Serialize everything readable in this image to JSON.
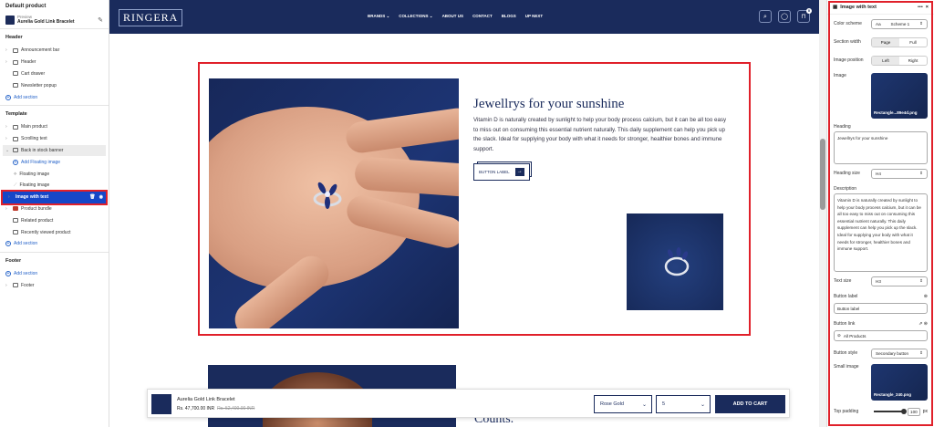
{
  "left_panel": {
    "title": "Default product",
    "preview_label": "Preview",
    "preview_product": "Aurelia Gold Link Bracelet",
    "header_group": {
      "title": "Header",
      "items": [
        "Announcement bar",
        "Header",
        "Cart drawer",
        "Newsletter popup"
      ],
      "add": "Add section"
    },
    "template_group": {
      "title": "Template",
      "items": [
        "Main product",
        "Scrolling text",
        "Back in stock banner"
      ],
      "add_floating": "Add Floating image",
      "floating_items": [
        "Floating image",
        "Floating image"
      ],
      "selected": "Image with text",
      "items_after": [
        "Product bundle",
        "Related product",
        "Recently viewed product"
      ],
      "add": "Add section"
    },
    "footer_group": {
      "title": "Footer",
      "add": "Add section",
      "items": [
        "Footer"
      ]
    }
  },
  "site": {
    "logo": "RINGERA",
    "menu": [
      "BRANDS ⌄",
      "COLLECTIONS ⌄",
      "ABOUT US",
      "CONTACT",
      "BLOGS",
      "UP NEXT"
    ],
    "heading": "Jewellrys for your sunshine",
    "description": "Vitamin D is naturally created by sunlight to help your body process calcium, but it can be all too easy to miss out on consuming this essential nutrient naturally. This daily supplement can help you pick up the slack. Ideal for supplying your body with what it needs for stronger, healthier bones and immune support.",
    "button_label": "BUTTON LABEL",
    "lower_text": "Counts.",
    "cart_badge": "0"
  },
  "sticky": {
    "name": "Aurelia Gold Link Bracelet",
    "price": "Rs. 47,700.00 INR",
    "old_price": "Rs. 52,400.00 INR",
    "variant": "Rose Gold",
    "size": "5",
    "cta": "ADD TO CART"
  },
  "right_panel": {
    "title": "Image with text",
    "dots": "•••",
    "color_scheme_label": "Color scheme",
    "color_scheme_value": "Scheme 1",
    "width_label": "Section width",
    "width_options": [
      "Page",
      "Full"
    ],
    "position_label": "Image position",
    "position_options": [
      "Left",
      "Right"
    ],
    "image_label": "Image",
    "image_file": "Rectangle...89e4d.png",
    "heading_label": "Heading",
    "heading_value": "Jewellrys for your sunshine",
    "heading_size_label": "Heading size",
    "heading_size_value": "H4",
    "description_label": "Description",
    "description_value": "Vitamin D is naturally created by sunlight to help your body process calcium, but it can be all too easy to miss out on consuming this essential nutrient naturally. This daily supplement can help you pick up the slack. Ideal for supplying your body with what it needs for stronger, healthier bones and immune support.",
    "text_size_label": "Text size",
    "text_size_value": "H3",
    "button_label_label": "Button label",
    "button_label_value": "Button label",
    "button_link_label": "Button link",
    "button_link_value": "All Products",
    "button_style_label": "Button style",
    "button_style_value": "Secondary button",
    "small_image_label": "Small image",
    "small_image_file": "Rectangle_240.png",
    "top_padding_label": "Top padding",
    "top_padding_value": "100",
    "top_padding_unit": "px",
    "top_padding_fraction": 1.0
  }
}
